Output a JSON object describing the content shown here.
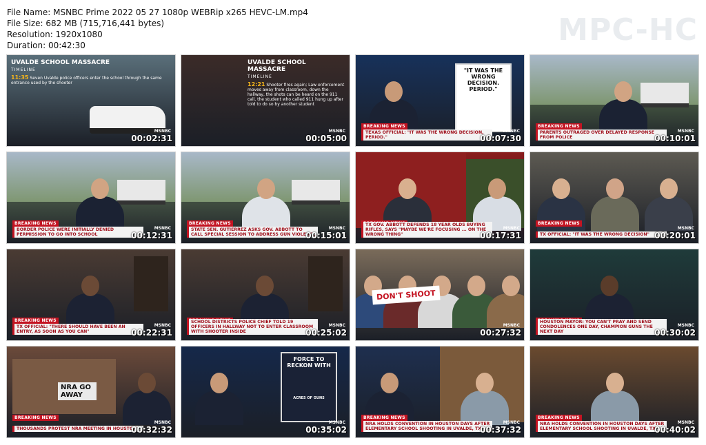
{
  "file_info": {
    "name_line": "File Name: MSNBC Prime 2022 05 27 1080p WEBRip x265 HEVC-LM.mp4",
    "size_line": "File Size: 682 MB (715,716,441 bytes)",
    "resolution_line": "Resolution: 1920x1080",
    "duration_line": "Duration: 00:42:30"
  },
  "logo": "MPC-HC",
  "thumbnails": [
    {
      "timestamp": "00:02:31",
      "breaking": "",
      "caption": "",
      "network": "MSNBC",
      "title": "UVALDE SCHOOL MASSACRE",
      "subtitle": "TIMELINE",
      "time": "11:35",
      "text": "Seven Uvalde police officers enter the school through the same entrance used by the shooter",
      "scene": "timeline",
      "bg": "#5a6f7a"
    },
    {
      "timestamp": "00:05:00",
      "breaking": "",
      "caption": "",
      "network": "MSNBC",
      "title": "UVALDE SCHOOL MASSACRE",
      "subtitle": "TIMELINE",
      "time": "12:21",
      "text": "Shooter fires again; Law enforcement moves away from classroom, down the hallway, the shots can be heard on the 911 call, the student who called 911 hung up after told to do so by another student",
      "scene": "timeline2",
      "bg": "#3b2b28"
    },
    {
      "timestamp": "00:07:30",
      "breaking": "BREAKING NEWS",
      "caption": "TEXAS OFFICIAL: \"IT WAS THE WRONG DECISION, PERIOD.\"",
      "network": "MSNBC",
      "card": "\"IT WAS THE WRONG DECISION. PERIOD.\"",
      "scene": "anchor",
      "bg": "#17315a"
    },
    {
      "timestamp": "00:10:01",
      "breaking": "BREAKING NEWS",
      "caption": "PARENTS OUTRAGED OVER DELAYED RESPONSE FROM POLICE",
      "network": "MSNBC",
      "scene": "field",
      "bg": "#6d8a5a"
    },
    {
      "timestamp": "00:12:31",
      "breaking": "BREAKING NEWS",
      "caption": "BORDER POLICE WERE INITIALLY DENIED PERMISSION TO GO INTO SCHOOL",
      "network": "MSNBC",
      "scene": "field",
      "bg": "#6f8761"
    },
    {
      "timestamp": "00:15:01",
      "breaking": "BREAKING NEWS",
      "caption": "STATE SEN. GUTIERREZ ASKS GOV. ABBOTT TO CALL SPECIAL SESSION TO ADDRESS GUN VIOLENCE",
      "network": "MSNBC",
      "scene": "field2",
      "bg": "#6d855e"
    },
    {
      "timestamp": "00:17:31",
      "breaking": "BREAKING NEWS",
      "caption": "TX GOV. ABBOTT DEFENDS 18 YEAR OLDS BUYING RIFLES, SAYS \"MAYBE WE'RE FOCUSING ... ON THE WRONG THING\"",
      "network": "MSNBC",
      "scene": "split",
      "bg": "#8a1c1c"
    },
    {
      "timestamp": "00:20:01",
      "breaking": "BREAKING NEWS",
      "caption": "TX OFFICIAL: \"IT WAS THE WRONG DECISION\"",
      "network": "MSNBC",
      "scene": "presser",
      "bg": "#5d5a52"
    },
    {
      "timestamp": "00:22:31",
      "breaking": "BREAKING NEWS",
      "caption": "TX OFFICIAL: \"THERE SHOULD HAVE BEEN AN ENTRY, AS SOON AS YOU CAN\"",
      "network": "MSNBC",
      "scene": "guest",
      "bg": "#4a3b33"
    },
    {
      "timestamp": "00:25:02",
      "breaking": "BREAKING NEWS",
      "caption": "SCHOOL DISTRICTS POLICE CHIEF TOLD 19 OFFICERS IN HALLWAY NOT TO ENTER CLASSROOM WITH SHOOTER INSIDE",
      "network": "MSNBC",
      "scene": "guest",
      "bg": "#4a3b33"
    },
    {
      "timestamp": "00:27:32",
      "breaking": "",
      "caption": "",
      "network": "MSNBC",
      "sign": "DON'T SHOOT",
      "scene": "crowd",
      "bg": "#7a6b5a"
    },
    {
      "timestamp": "00:30:02",
      "breaking": "BREAKING NEWS",
      "caption": "HOUSTON MAYOR: YOU CAN'T PRAY AND SEND CONDOLENCES ONE DAY, CHAMPION GUNS THE NEXT DAY",
      "network": "MSNBC",
      "scene": "mayor",
      "bg": "#1f3b3a"
    },
    {
      "timestamp": "00:32:32",
      "breaking": "BREAKING NEWS",
      "caption": "THOUSANDS PROTEST NRA MEETING IN HOUSTON",
      "network": "MSNBC",
      "sign": "NRA GO AWAY",
      "scene": "protest",
      "bg": "#6b4a3a"
    },
    {
      "timestamp": "00:35:02",
      "breaking": "",
      "caption": "",
      "network": "MSNBC",
      "card": "FORCE TO RECKON WITH",
      "card_sub": "ACRES OF GUNS",
      "scene": "anchor2",
      "bg": "#15284a"
    },
    {
      "timestamp": "00:37:32",
      "breaking": "BREAKING NEWS",
      "caption": "NRA HOLDS CONVENTION IN HOUSTON DAYS AFTER ELEMENTARY SCHOOL SHOOTING IN UVALDE, TX",
      "network": "MSNBC",
      "scene": "twoshot",
      "bg": "#1e2f4f"
    },
    {
      "timestamp": "00:40:02",
      "breaking": "BREAKING NEWS",
      "caption": "NRA HOLDS CONVENTION IN HOUSTON DAYS AFTER ELEMENTARY SCHOOL SHOOTING IN UVALDE, TX",
      "network": "MSNBC",
      "scene": "home",
      "bg": "#6a4a2f"
    }
  ]
}
